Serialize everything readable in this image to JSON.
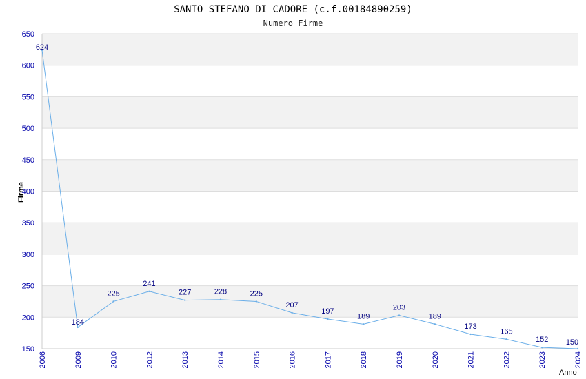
{
  "chart_data": {
    "type": "line",
    "title": "SANTO STEFANO DI CADORE (c.f.00184890259)",
    "subtitle": "Numero Firme",
    "xlabel": "Anno",
    "ylabel": "Firme",
    "categories": [
      "2006",
      "2009",
      "2010",
      "2012",
      "2013",
      "2014",
      "2015",
      "2016",
      "2017",
      "2018",
      "2019",
      "2020",
      "2021",
      "2022",
      "2023",
      "2024"
    ],
    "series": [
      {
        "values": [
          624,
          184,
          225,
          241,
          227,
          228,
          225,
          207,
          197,
          189,
          203,
          189,
          173,
          165,
          152,
          150
        ]
      }
    ],
    "ylim": [
      150,
      650
    ],
    "yticks": [
      150,
      200,
      250,
      300,
      350,
      400,
      450,
      500,
      550,
      600,
      650
    ],
    "grid": true,
    "colors": {
      "line": "#6aaee8",
      "tick_label": "#0000aa",
      "data_label": "#000080",
      "band": "#f2f2f2",
      "grid": "#dddddd"
    }
  }
}
